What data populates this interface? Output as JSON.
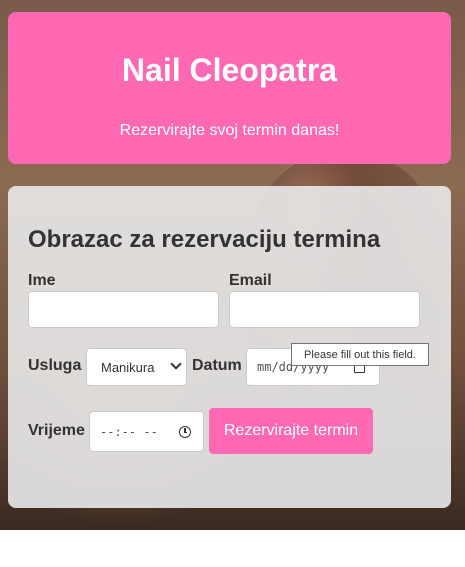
{
  "header": {
    "title": "Nail Cleopatra",
    "subtitle": "Rezervirajte svoj termin danas!"
  },
  "form": {
    "heading": "Obrazac za rezervaciju termina",
    "name_label": "Ime",
    "name_value": "",
    "email_label": "Email",
    "email_value": "",
    "service_label": "Usluga",
    "service_value": "Manikura",
    "date_label": "Datum",
    "date_placeholder": "mm/dd/yyyy",
    "time_label": "Vrijeme",
    "time_placeholder": "--:-- --",
    "submit_label": "Rezervirajte termin"
  },
  "tooltip": {
    "text": "Please fill out this field."
  },
  "colors": {
    "accent": "#ff69b4",
    "card": "#e6e6e6",
    "text": "#333333"
  },
  "icons": [
    "chevron-down-icon",
    "calendar-icon",
    "clock-icon"
  ]
}
